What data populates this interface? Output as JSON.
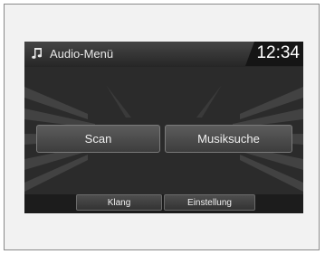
{
  "header": {
    "title": "Audio-Menü",
    "clock": "12:34",
    "icon": "music-note-icon"
  },
  "main_buttons": {
    "scan_label": "Scan",
    "musiksuche_label": "Musiksuche"
  },
  "bottom_buttons": {
    "klang_label": "Klang",
    "einstellung_label": "Einstellung"
  },
  "colors": {
    "screen_bg": "#2b2b2b",
    "button_fill": "#4d4d4d",
    "text": "#f0f0f0"
  }
}
